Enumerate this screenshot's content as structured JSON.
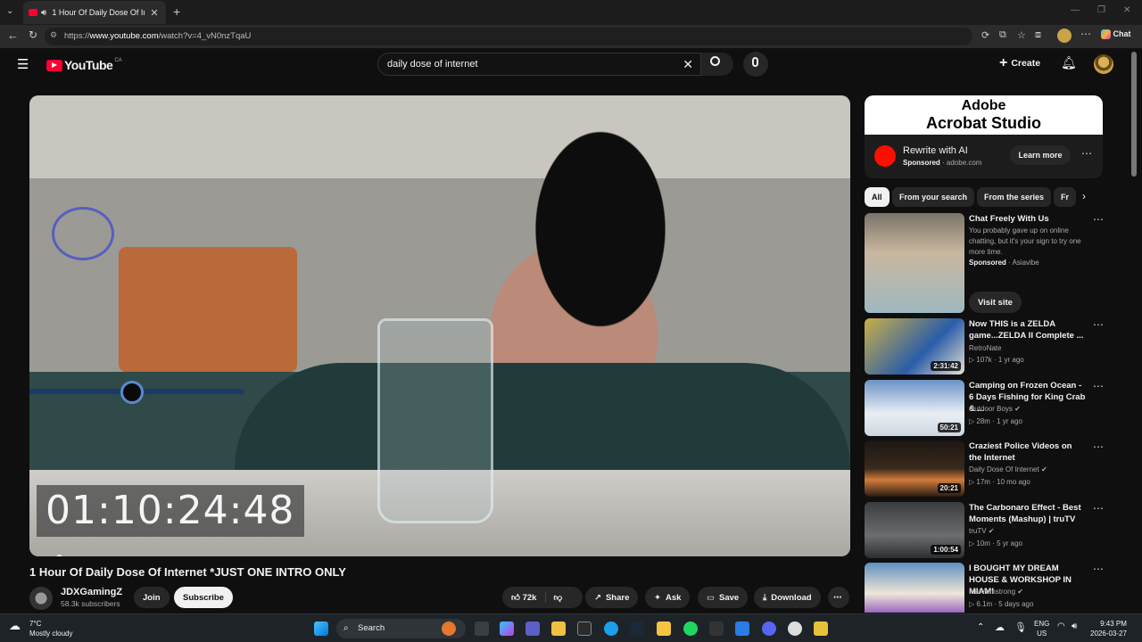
{
  "browser": {
    "tab_title": "1 Hour Of Daily Dose Of Inter",
    "url_prefix": "https://",
    "url_host": "www.youtube.com",
    "url_path": "/watch?v=4_vN0nzTqaU",
    "chat_label": "Chat"
  },
  "youtube": {
    "logo_text": "YouTube",
    "country_code": "CA",
    "search_value": "daily dose of internet",
    "create_label": "Create"
  },
  "video": {
    "timer_text": "01:10:24:48",
    "title": "1 Hour Of Daily Dose Of Internet *JUST ONE INTRO ONLY",
    "channel": "JDXGamingZ",
    "subscribers": "58.3k subscribers",
    "join_label": "Join",
    "subscribe_label": "Subscribe",
    "likes": "72k",
    "share_label": "Share",
    "ask_label": "Ask",
    "save_label": "Save",
    "download_label": "Download"
  },
  "ad": {
    "brand_line1": "Adobe",
    "brand_line2": "Acrobat Studio",
    "title": "Rewrite with AI",
    "sponsored": "Sponsored",
    "domain": "adobe.com",
    "cta": "Learn more"
  },
  "chips": [
    "All",
    "From your search",
    "From the series",
    "Fr"
  ],
  "recommendations": [
    {
      "title": "Chat Freely With Us",
      "desc": "You probably gave up on online chatting, but it's your sign to try one more time.",
      "sponsored": "Sponsored",
      "channel": "Asiavibe",
      "cta": "Visit site"
    },
    {
      "title": "Now THIS is a ZELDA game...ZELDA II Complete ...",
      "channel": "RetroNate",
      "meta": "107k · 1 yr ago",
      "duration": "2:31:42"
    },
    {
      "title": "Camping on Frozen Ocean - 6 Days Fishing for King Crab & ...",
      "channel": "Outdoor Boys",
      "meta": "28m · 1 yr ago",
      "duration": "50:21"
    },
    {
      "title": "Craziest Police Videos on the Internet",
      "channel": "Daily Dose Of Internet",
      "meta": "17m · 10 mo ago",
      "duration": "20:21"
    },
    {
      "title": "The Carbonaro Effect - Best Moments (Mashup) | truTV",
      "channel": "truTV",
      "meta": "10m · 5 yr ago",
      "duration": "1:00:54"
    },
    {
      "title": "I BOUGHT MY DREAM HOUSE & WORKSHOP IN MIAMI",
      "channel": "Mat Armstrong",
      "meta": "6.1m · 5 days ago",
      "duration": ""
    }
  ],
  "taskbar": {
    "temp": "7°C",
    "condition": "Mostly cloudy",
    "search_label": "Search",
    "lang1": "ENG",
    "lang2": "US",
    "time": "9:43 PM",
    "date": "2026-03-27"
  }
}
